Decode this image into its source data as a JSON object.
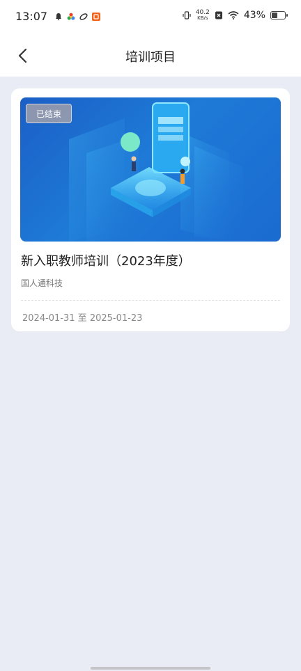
{
  "status_bar": {
    "time": "13:07",
    "netspeed_value": "40.2",
    "netspeed_unit": "KB/s",
    "battery_percent": "43%",
    "icons": [
      "bell-icon",
      "colorful-app-icon",
      "link-app-icon",
      "orange-app-icon",
      "vibrate-icon",
      "sim-x-icon",
      "wifi-icon",
      "battery-icon"
    ]
  },
  "header": {
    "title": "培训项目",
    "back_icon": "chevron-left-icon"
  },
  "card": {
    "badge": "已结束",
    "title": "新入职教师培训（2023年度）",
    "org": "国人通科技",
    "date_range": "2024-01-31 至 2025-01-23"
  },
  "colors": {
    "background": "#e9ecf5",
    "cover_blue": "#1e7ad6"
  }
}
